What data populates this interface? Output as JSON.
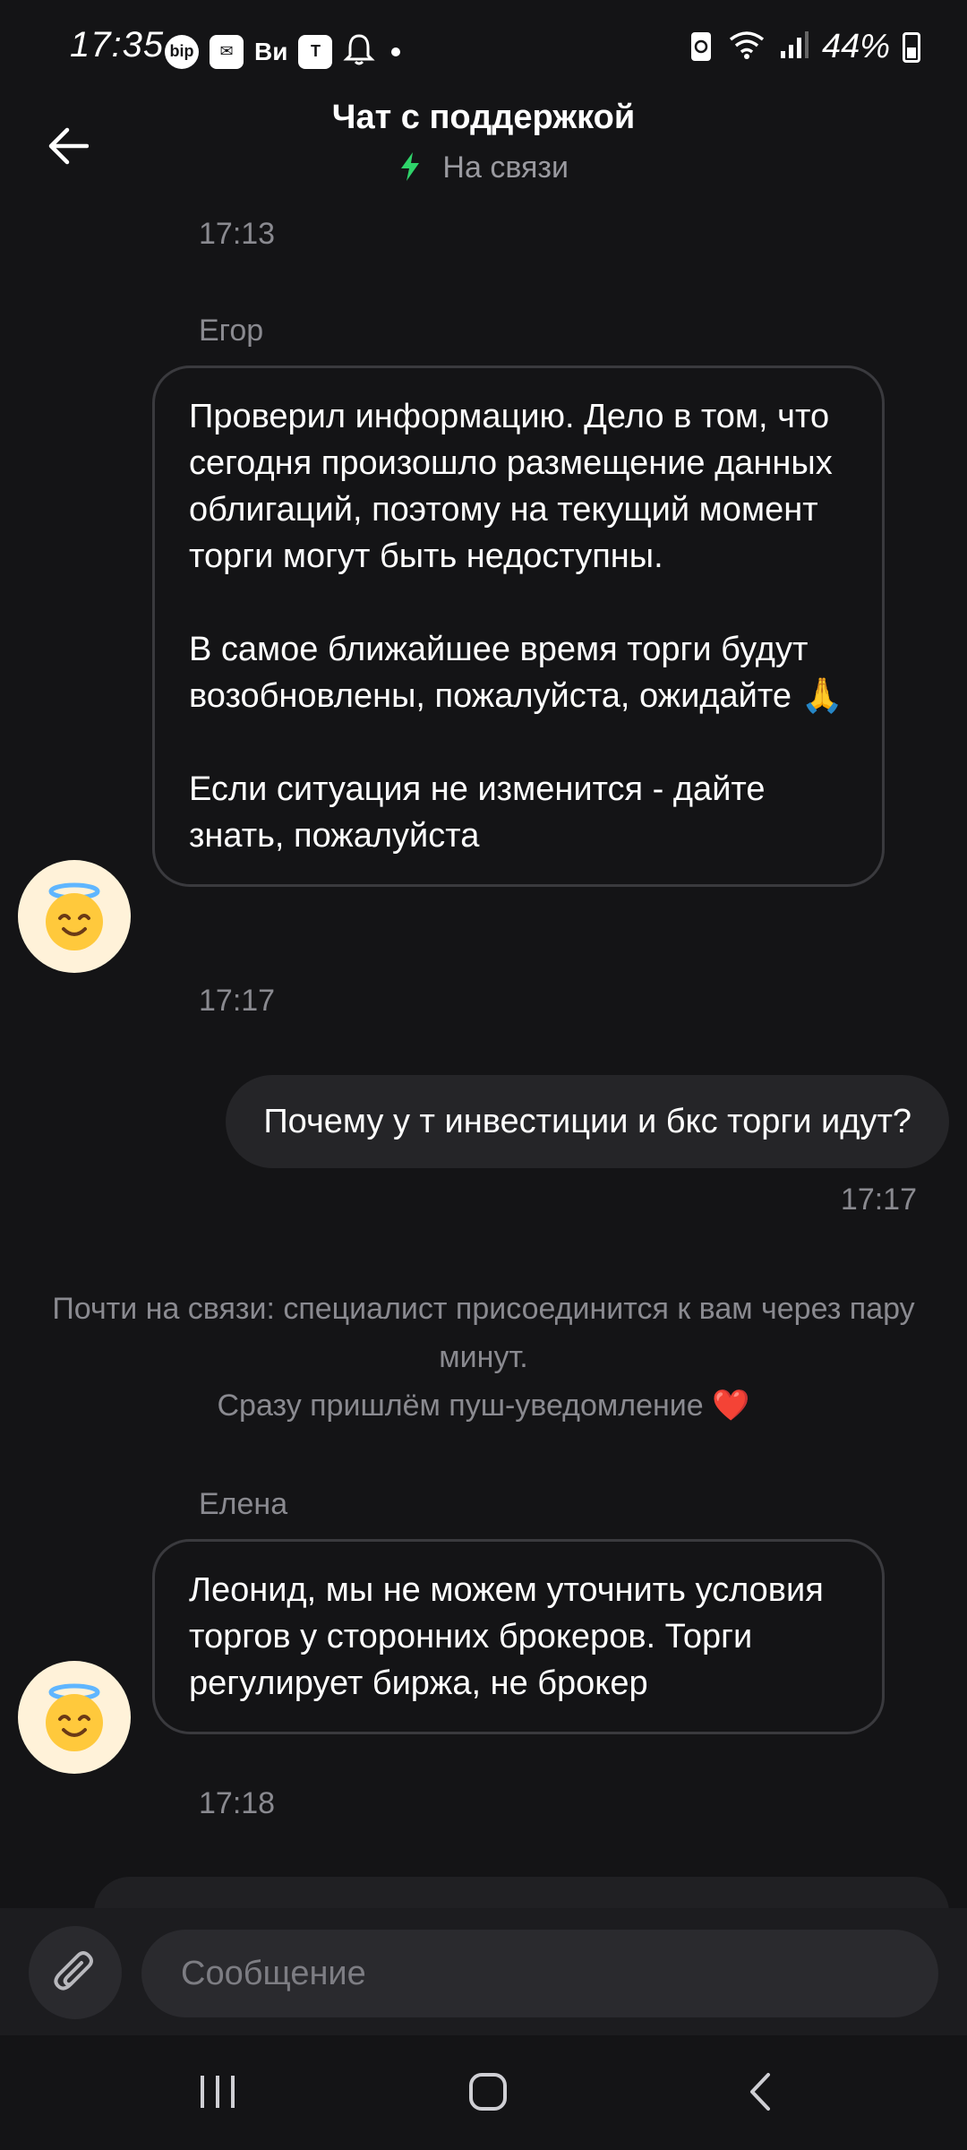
{
  "status_bar": {
    "time": "17:35",
    "icons_left": [
      "bip-icon",
      "mail-icon",
      "vk-icon",
      "tinkoff-icon",
      "bell-icon"
    ],
    "vk_label": "Ви",
    "bip_label": "bip",
    "tinkoff_label": "T",
    "battery_text": "44%",
    "battery_level": 0.44
  },
  "header": {
    "title": "Чат с поддержкой",
    "status": "На связи",
    "status_color": "#2fd36a"
  },
  "messages": [
    {
      "type": "timestamp",
      "text": "17:13"
    },
    {
      "type": "incoming",
      "sender": "Егор",
      "paragraphs": [
        "Проверил информацию. Дело в том, что сегодня произошло размещение данных облигаций, поэтому на текущий момент торги могут быть недоступны.",
        "В самое ближайшее время торги будут возобновлены, пожалуйста, ожидайте 🙏",
        "Если ситуация не изменится - дайте знать, пожалуйста"
      ],
      "time": "17:17"
    },
    {
      "type": "outgoing",
      "text": "Почему у т инвестиции и бкс торги идут?",
      "time": "17:17"
    },
    {
      "type": "system",
      "line1": "Почти на связи: специалист присоединится к вам через пару минут.",
      "line2": "Сразу пришлём пуш-уведомление ❤️"
    },
    {
      "type": "incoming",
      "sender": "Елена",
      "paragraphs": [
        "Леонид, мы не можем уточнить условия торгов у сторонних брокеров. Торги регулирует биржа, не брокер"
      ],
      "time": "17:18"
    }
  ],
  "typing_indicator": "...",
  "input": {
    "placeholder": "Сообщение",
    "value": ""
  },
  "nav": [
    "recent-apps",
    "home",
    "back"
  ]
}
